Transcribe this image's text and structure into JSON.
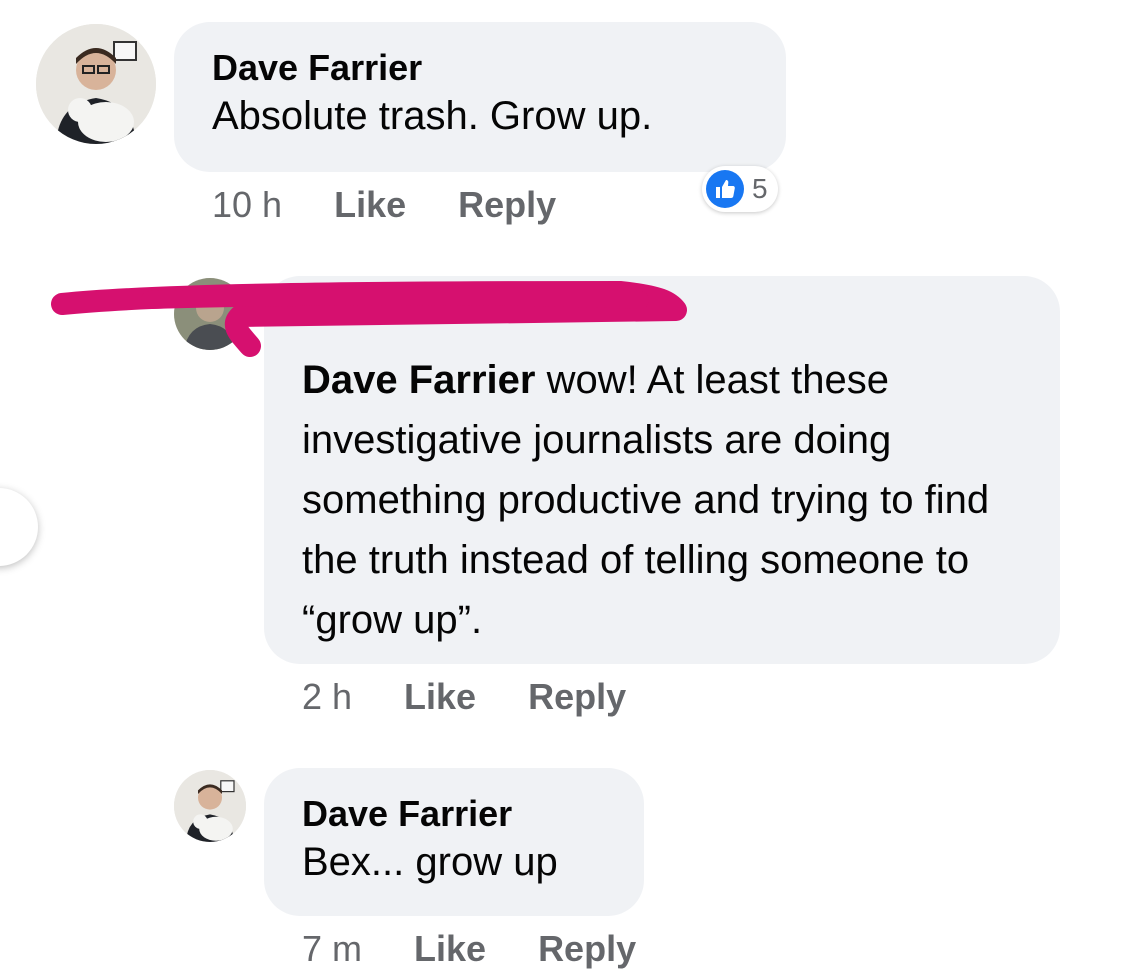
{
  "comments": [
    {
      "author": "Dave Farrier",
      "text": "Absolute trash. Grow up.",
      "time": "10 h",
      "like_label": "Like",
      "reply_label": "Reply",
      "reaction_count": "5",
      "reaction_icon": "thumbs-up-icon"
    },
    {
      "mention": "Dave Farrier",
      "text": " wow! At least these investigative journalists are doing something productive and trying to find the truth instead of telling someone to “grow up”.",
      "time": "2 h",
      "like_label": "Like",
      "reply_label": "Reply"
    },
    {
      "author": "Dave Farrier",
      "text": "Bex... grow up",
      "time": "7 m",
      "like_label": "Like",
      "reply_label": "Reply"
    }
  ],
  "colors": {
    "bubble": "#f0f2f5",
    "meta_text": "#65676b",
    "like_blue": "#1877f2",
    "redaction_magenta": "#d6106f"
  }
}
